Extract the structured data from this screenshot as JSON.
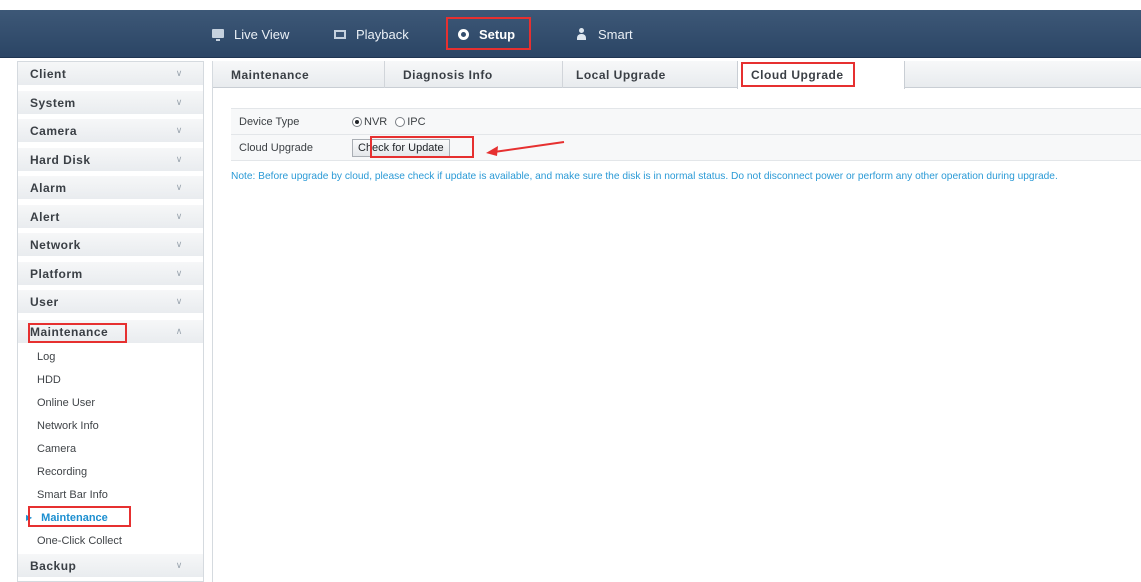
{
  "nav": {
    "items": [
      {
        "label": "Live View",
        "icon": "monitor-icon"
      },
      {
        "label": "Playback",
        "icon": "film-icon"
      },
      {
        "label": "Setup",
        "icon": "gear-icon"
      },
      {
        "label": "Smart",
        "icon": "person-icon"
      }
    ],
    "active": "Setup"
  },
  "sidebar": {
    "items": [
      {
        "label": "Client"
      },
      {
        "label": "System"
      },
      {
        "label": "Camera"
      },
      {
        "label": "Hard Disk"
      },
      {
        "label": "Alarm"
      },
      {
        "label": "Alert"
      },
      {
        "label": "Network"
      },
      {
        "label": "Platform"
      },
      {
        "label": "User"
      },
      {
        "label": "Maintenance",
        "expanded": true
      },
      {
        "label": "Backup"
      }
    ],
    "sub_items": [
      {
        "label": "Log"
      },
      {
        "label": "HDD"
      },
      {
        "label": "Online User"
      },
      {
        "label": "Network Info"
      },
      {
        "label": "Camera"
      },
      {
        "label": "Recording"
      },
      {
        "label": "Smart Bar Info"
      },
      {
        "label": "Maintenance",
        "active": true
      },
      {
        "label": "One-Click Collect"
      }
    ]
  },
  "tabs": [
    {
      "label": "Maintenance"
    },
    {
      "label": "Diagnosis Info"
    },
    {
      "label": "Local Upgrade"
    },
    {
      "label": "Cloud Upgrade",
      "active": true
    }
  ],
  "form": {
    "device_type_label": "Device Type",
    "device_type_options": [
      "NVR",
      "IPC"
    ],
    "device_type_selected": "NVR",
    "cloud_upgrade_label": "Cloud Upgrade",
    "check_button_label": "Check for Update"
  },
  "note": "Note: Before upgrade by cloud, please check if update is available, and make sure the disk is in normal status. Do not disconnect power or perform any other operation during upgrade.",
  "colors": {
    "header": "#2f4a6a",
    "highlight_red": "#e63030",
    "note_blue": "#2b9ad6",
    "active_blue": "#1c8fd0"
  }
}
